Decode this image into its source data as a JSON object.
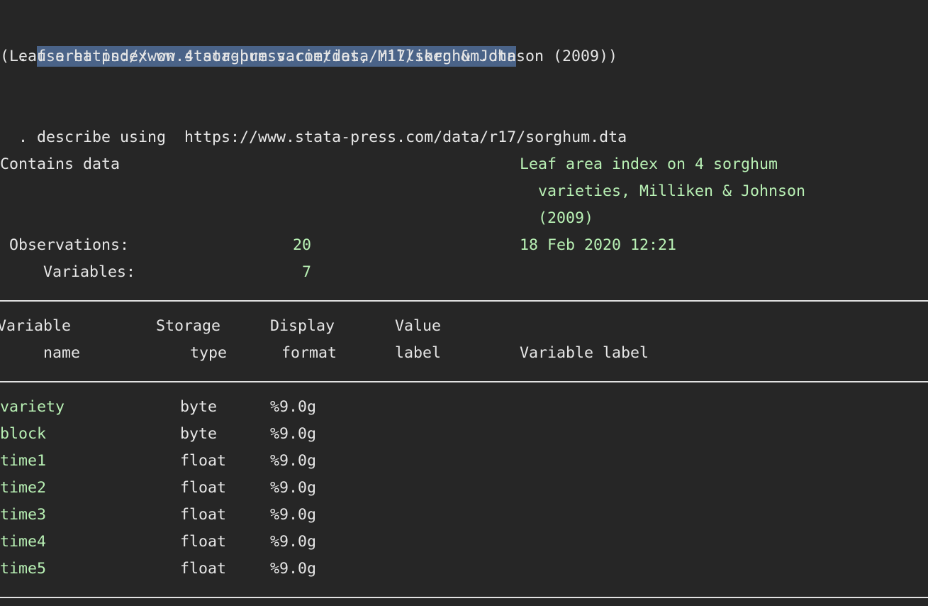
{
  "app": "Stata Results Window",
  "commands": {
    "use": {
      "prompt": ".",
      "text": "use https://www.stata-press.com/data/r17/sorghum.dta",
      "output": "(Leaf area index on 4 sorghum varieties, Milliken & Johnson (2009))"
    },
    "describe": {
      "prompt": ".",
      "text": "describe using  https://www.stata-press.com/data/r17/sorghum.dta"
    }
  },
  "describe_output": {
    "contains_label": "Contains data",
    "dataset_label_lines": [
      "Leaf area index on 4 sorghum",
      "  varieties, Milliken & Johnson",
      "  (2009)"
    ],
    "observations_label": "Observations:",
    "observations_value": "20",
    "variables_label": "Variables:",
    "variables_value": "7",
    "timestamp": "18 Feb 2020 12:21",
    "headers": {
      "row1": {
        "variable": "Variable",
        "storage": "Storage",
        "display": "Display",
        "value": "Value"
      },
      "row2": {
        "variable": "name",
        "storage": "type",
        "display": "format",
        "value": "label",
        "varlabel": "Variable label"
      }
    },
    "variables": [
      {
        "name": "variety",
        "type": "byte",
        "format": "%9.0g"
      },
      {
        "name": "block",
        "type": "byte",
        "format": "%9.0g"
      },
      {
        "name": "time1",
        "type": "float",
        "format": "%9.0g"
      },
      {
        "name": "time2",
        "type": "float",
        "format": "%9.0g"
      },
      {
        "name": "time3",
        "type": "float",
        "format": "%9.0g"
      },
      {
        "name": "time4",
        "type": "float",
        "format": "%9.0g"
      },
      {
        "name": "time5",
        "type": "float",
        "format": "%9.0g"
      }
    ]
  },
  "colors": {
    "background": "#262626",
    "text": "#e6e6e6",
    "result_green": "#b8f0b4",
    "selection": "#4a6388"
  }
}
